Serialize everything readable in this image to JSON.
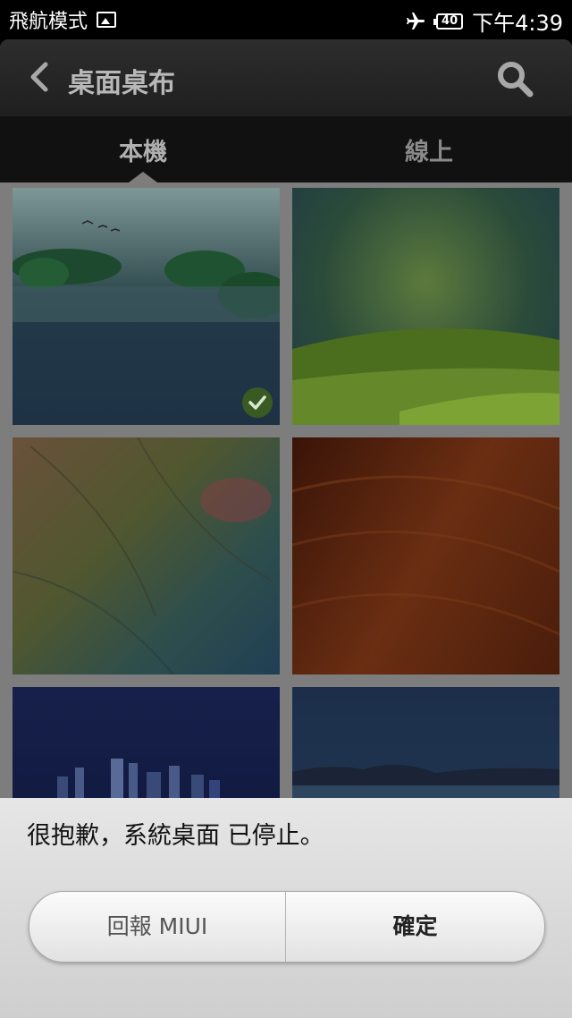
{
  "status_bar": {
    "mode_text": "飛航模式",
    "image_icon": "image-icon",
    "airplane_icon": "airplane-icon",
    "battery_level": "40",
    "time": "下午4:39"
  },
  "action_bar": {
    "title": "桌面桌布",
    "back_icon": "back-chevron-icon",
    "search_icon": "search-icon"
  },
  "tabs": [
    {
      "label": "本機",
      "selected": true
    },
    {
      "label": "線上",
      "selected": false
    }
  ],
  "wallpapers": [
    {
      "name": "misty-lake",
      "selected": true
    },
    {
      "name": "green-hills",
      "selected": false
    },
    {
      "name": "feathers",
      "selected": false
    },
    {
      "name": "red-wood-grain",
      "selected": false
    },
    {
      "name": "city-night",
      "selected": false
    },
    {
      "name": "lake-dusk",
      "selected": false
    }
  ],
  "dialog": {
    "message": "很抱歉，系統桌面 已停止。",
    "report_button": "回報 MIUI",
    "ok_button": "確定"
  },
  "colors": {
    "accent_check": "#3a5a24",
    "action_bar_bg": "#262626",
    "dialog_bg": "#dcdcdc"
  }
}
